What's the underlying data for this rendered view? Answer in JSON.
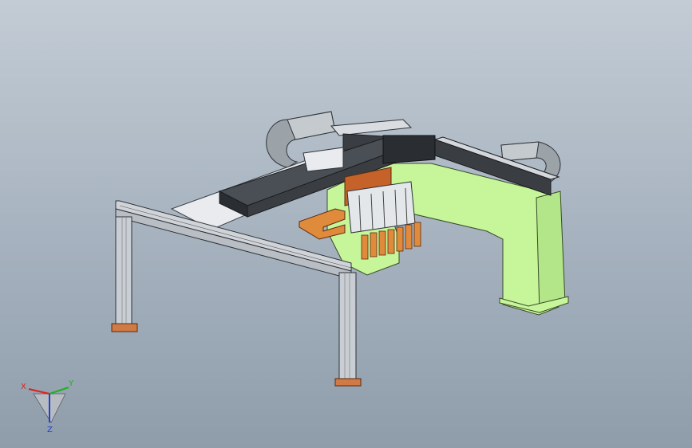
{
  "viewport": {
    "background_top": "#c3ccd5",
    "background_bottom": "#8f9dab"
  },
  "triad": {
    "x_label": "X",
    "y_label": "Y",
    "z_label": "Z",
    "x_color": "#e0201c",
    "y_color": "#20b020",
    "z_color": "#2040d0"
  },
  "model": {
    "frame_color": "#c9ced4",
    "green_support_color": "#c6f59a",
    "carriage_color": "#2a2e33",
    "plate_color": "#e9ebee",
    "bracket_color": "#c4622a",
    "foot_color": "#d07a45",
    "gripper_color": "#e08a3c"
  }
}
